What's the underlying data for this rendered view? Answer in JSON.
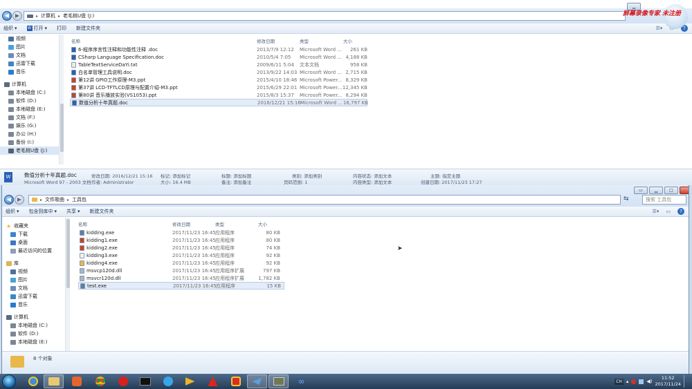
{
  "window1": {
    "breadcrumb": [
      "计算机",
      "老毛桃U盘 (J:)"
    ],
    "toolbar": {
      "organize": "组织",
      "open": "打开",
      "print": "打印",
      "new_folder": "新建文件夹"
    },
    "columns": {
      "name": "名称",
      "modified": "修改日期",
      "type": "类型",
      "size": "大小"
    },
    "nav": [
      {
        "label": "视频",
        "icon": "video-icon"
      },
      {
        "label": "图片",
        "icon": "picture-icon"
      },
      {
        "label": "文档",
        "icon": "document-icon"
      },
      {
        "label": "迅雷下载",
        "icon": "download-icon"
      },
      {
        "label": "音乐",
        "icon": "music-icon"
      },
      {
        "label": "计算机",
        "icon": "computer-icon",
        "head": true
      },
      {
        "label": "本地磁盘 (C:)",
        "icon": "drive-icon"
      },
      {
        "label": "软件 (D:)",
        "icon": "drive-icon"
      },
      {
        "label": "本地磁盘 (E:)",
        "icon": "drive-icon"
      },
      {
        "label": "文档 (F:)",
        "icon": "drive-icon"
      },
      {
        "label": "娱乐 (G:)",
        "icon": "drive-icon"
      },
      {
        "label": "办公 (H:)",
        "icon": "drive-icon"
      },
      {
        "label": "备份 (I:)",
        "icon": "drive-icon"
      },
      {
        "label": "老毛桃U盘 (J:)",
        "icon": "usb-drive-icon",
        "selected": true
      }
    ],
    "files": [
      {
        "name": "6-程序序言性注释和功能性注释 .doc",
        "modified": "2013/7/9 12:12",
        "type": "Microsoft Word ...",
        "size": "261 KB",
        "icon": "word",
        "selected": false
      },
      {
        "name": "CSharp Language Specification.doc",
        "modified": "2010/5/4 7:05",
        "type": "Microsoft Word ...",
        "size": "4,188 KB",
        "icon": "word",
        "selected": false
      },
      {
        "name": "TableTextServiceDaYi.txt",
        "modified": "2009/6/11 5:04",
        "type": "文本文档",
        "size": "958 KB",
        "icon": "txt",
        "selected": false
      },
      {
        "name": "白名单管理工具说明.doc",
        "modified": "2013/9/22 14:03",
        "type": "Microsoft Word ...",
        "size": "2,715 KB",
        "icon": "word",
        "selected": false
      },
      {
        "name": "第12讲 GPIO工作原理-M3.ppt",
        "modified": "2015/4/10 18:46",
        "type": "Microsoft Power...",
        "size": "8,329 KB",
        "icon": "ppt",
        "selected": false
      },
      {
        "name": "第37讲 LCD-TFTLCD原理与配置介绍-M3.ppt",
        "modified": "2015/6/29 22:01",
        "type": "Microsoft Power...",
        "size": "12,345 KB",
        "icon": "ppt",
        "selected": false
      },
      {
        "name": "第80讲 音乐播放实验(VS1053).ppt",
        "modified": "2015/8/3 15:37",
        "type": "Microsoft Power...",
        "size": "8,294 KB",
        "icon": "ppt",
        "selected": false
      },
      {
        "name": "数值分析十年真题.doc",
        "modified": "2016/12/21 15:16",
        "type": "Microsoft Word ...",
        "size": "16,797 KB",
        "icon": "word",
        "selected": true
      }
    ],
    "details": {
      "filename": "数值分析十年真题.doc",
      "filetype": "Microsoft Word 97 - 2003 文档",
      "f1": "修改日期: 2016/12/21 15:16",
      "f2": "作者: Administrator",
      "f3": "标记: 添加标记",
      "f4": "大小: 16.4 MB",
      "f5": "标题: 添加标题",
      "f6": "备注: 添加备注",
      "f7": "类别: 添加类别",
      "f8": "页码范围: 1",
      "f9": "内容状态: 添加文本",
      "f10": "内容类型: 添加文本",
      "f11": "主题: 指定主题",
      "f12": "创建日期: 2017/11/23 17:27"
    }
  },
  "window2": {
    "breadcrumb": [
      "文件歌曲",
      "工具包"
    ],
    "search_placeholder": "搜索 工具包",
    "toolbar": {
      "organize": "组织",
      "include": "包含到库中",
      "share": "共享",
      "new_folder": "新建文件夹"
    },
    "columns": {
      "name": "名称",
      "modified": "修改日期",
      "type": "类型",
      "size": "大小"
    },
    "nav": [
      {
        "label": "收藏夹",
        "icon": "star-icon",
        "head": true
      },
      {
        "label": "下载",
        "icon": "download-icon"
      },
      {
        "label": "桌面",
        "icon": "desktop-icon"
      },
      {
        "label": "最近访问的位置",
        "icon": "recent-icon"
      },
      {
        "label": "库",
        "icon": "library-icon",
        "head": true
      },
      {
        "label": "视频",
        "icon": "video-icon"
      },
      {
        "label": "图片",
        "icon": "picture-icon"
      },
      {
        "label": "文档",
        "icon": "document-icon"
      },
      {
        "label": "迅雷下载",
        "icon": "download-icon"
      },
      {
        "label": "音乐",
        "icon": "music-icon"
      },
      {
        "label": "计算机",
        "icon": "computer-icon",
        "head": true
      },
      {
        "label": "本地磁盘 (C:)",
        "icon": "drive-icon"
      },
      {
        "label": "软件 (D:)",
        "icon": "drive-icon"
      },
      {
        "label": "本地磁盘 (E:)",
        "icon": "drive-icon"
      }
    ],
    "files": [
      {
        "name": "kidding.exe",
        "modified": "2017/11/23 16:45",
        "type": "应用程序",
        "size": "80 KB",
        "icon": "exe",
        "selected": false
      },
      {
        "name": "kidding1.exe",
        "modified": "2017/11/23 16:45",
        "type": "应用程序",
        "size": "80 KB",
        "icon": "exe-red",
        "selected": false
      },
      {
        "name": "kidding2.exe",
        "modified": "2017/11/23 16:45",
        "type": "应用程序",
        "size": "74 KB",
        "icon": "exe-red",
        "selected": false
      },
      {
        "name": "kidding3.exe",
        "modified": "2017/11/23 16:45",
        "type": "应用程序",
        "size": "92 KB",
        "icon": "exe-blank",
        "selected": false
      },
      {
        "name": "kidding4.exe",
        "modified": "2017/11/23 16:45",
        "type": "应用程序",
        "size": "92 KB",
        "icon": "exe-folder",
        "selected": false
      },
      {
        "name": "msvcp120d.dll",
        "modified": "2017/11/23 16:45",
        "type": "应用程序扩展",
        "size": "797 KB",
        "icon": "dll",
        "selected": false
      },
      {
        "name": "msvcr120d.dll",
        "modified": "2017/11/23 16:45",
        "type": "应用程序扩展",
        "size": "1,782 KB",
        "icon": "dll",
        "selected": false
      },
      {
        "name": "test.exe",
        "modified": "2017/11/23 16:45",
        "type": "应用程序",
        "size": "15 KB",
        "icon": "exe",
        "selected": true
      }
    ],
    "status": "8 个对象"
  },
  "watermark": "屏幕录像专家 未注册",
  "clock": {
    "time": "11:52",
    "date": "2017/11/24"
  },
  "tray_lang": "CH",
  "colors": {
    "word": "#2b5fb4",
    "ppt": "#c8432b",
    "txt": "#e9edf2",
    "exe": "#5b7fa8",
    "dll": "#a9b6c6",
    "folder": "#e8b84a"
  }
}
